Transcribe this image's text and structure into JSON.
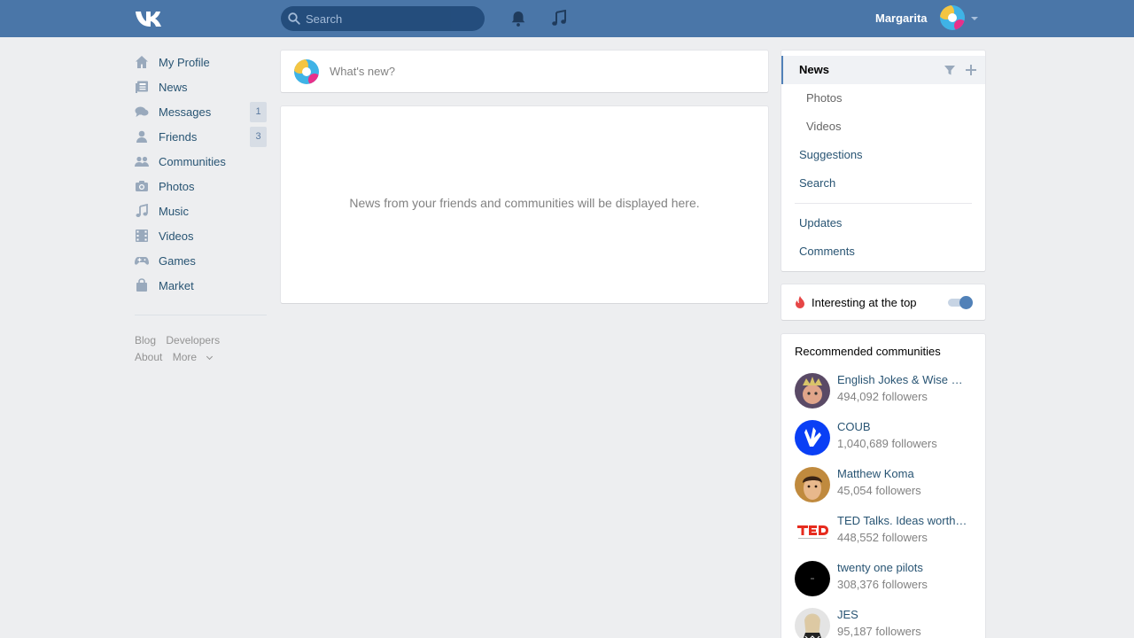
{
  "header": {
    "search_placeholder": "Search",
    "user_name": "Margarita"
  },
  "leftnav": {
    "items": [
      {
        "label": "My Profile",
        "icon": "home-icon"
      },
      {
        "label": "News",
        "icon": "news-icon"
      },
      {
        "label": "Messages",
        "icon": "messages-icon",
        "badge": "1"
      },
      {
        "label": "Friends",
        "icon": "friends-icon",
        "badge": "3"
      },
      {
        "label": "Communities",
        "icon": "communities-icon"
      },
      {
        "label": "Photos",
        "icon": "camera-icon"
      },
      {
        "label": "Music",
        "icon": "music-icon"
      },
      {
        "label": "Videos",
        "icon": "film-icon"
      },
      {
        "label": "Games",
        "icon": "gamepad-icon"
      },
      {
        "label": "Market",
        "icon": "bag-icon"
      }
    ],
    "footer": {
      "blog": "Blog",
      "developers": "Developers",
      "about": "About",
      "more": "More"
    }
  },
  "composer": {
    "placeholder": "What's new?"
  },
  "feed": {
    "empty_text": "News from your friends and communities will be displayed here."
  },
  "right_menu": {
    "items": [
      {
        "label": "News"
      },
      {
        "label": "Photos"
      },
      {
        "label": "Videos"
      },
      {
        "label": "Suggestions"
      },
      {
        "label": "Search"
      },
      {
        "label": "Updates"
      },
      {
        "label": "Comments"
      }
    ]
  },
  "interesting": {
    "label": "Interesting at the top",
    "enabled": true
  },
  "recommended": {
    "title": "Recommended communities",
    "items": [
      {
        "name": "English Jokes & Wise Quotes",
        "followers": "494,092 followers"
      },
      {
        "name": "COUB",
        "followers": "1,040,689 followers"
      },
      {
        "name": "Matthew Koma",
        "followers": "45,054 followers"
      },
      {
        "name": "TED Talks. Ideas worth spreading",
        "followers": "448,552 followers"
      },
      {
        "name": "twenty one pilots",
        "followers": "308,376 followers"
      },
      {
        "name": "JES",
        "followers": "95,187 followers"
      }
    ]
  },
  "colors": {
    "header": "#4a76a8",
    "link": "#285473",
    "accent": "#5181b8",
    "background": "#edeef0"
  }
}
